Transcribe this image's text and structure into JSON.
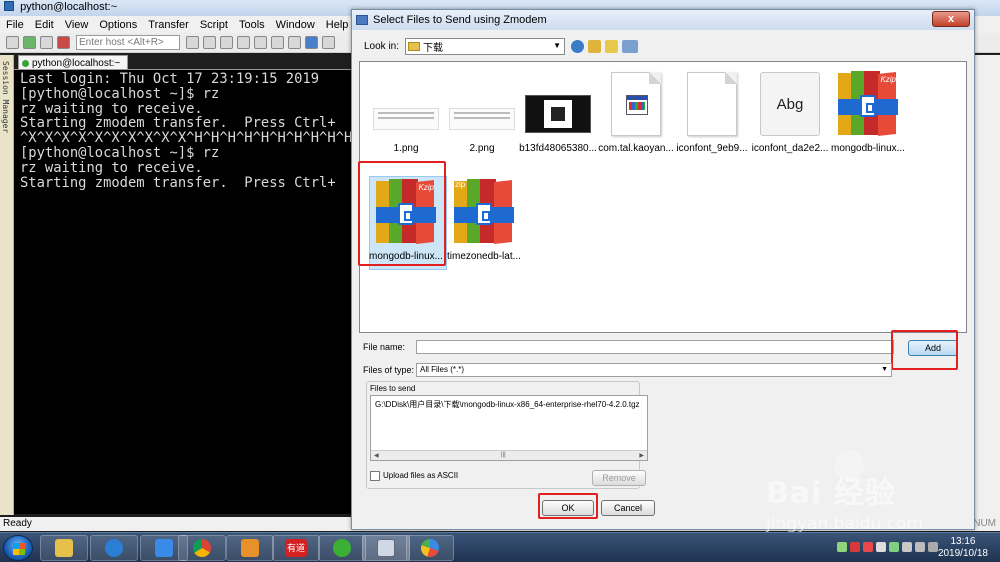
{
  "crt": {
    "title": "python@localhost:~",
    "menu": [
      "File",
      "Edit",
      "View",
      "Options",
      "Transfer",
      "Script",
      "Tools",
      "Window",
      "Help"
    ],
    "host_placeholder": "Enter host <Alt+R>",
    "session_manager_label": "Session Manager",
    "tab_label": "python@localhost:~",
    "terminal_lines": [
      "Last login: Thu Oct 17 23:19:15 2019",
      "[python@localhost ~]$ rz",
      "rz waiting to receive.",
      "Starting zmodem transfer.  Press Ctrl+",
      "",
      "^X^X^X^X^X^X^X^X^X^X^H^H^H^H^H^H^H^H^H^H^",
      "[python@localhost ~]$ rz",
      "rz waiting to receive.",
      "Starting zmodem transfer.  Press Ctrl+"
    ],
    "status_text": "Ready",
    "status_right": "NUM"
  },
  "dialog": {
    "title": "Select Files to Send using Zmodem",
    "close_label": "x",
    "look_in_label": "Look in:",
    "look_in_value": "下载",
    "files": [
      {
        "name": "1.png",
        "kind": "png"
      },
      {
        "name": "2.png",
        "kind": "png"
      },
      {
        "name": "b13fd48065380...",
        "kind": "qr"
      },
      {
        "name": "com.tal.kaoyan...",
        "kind": "app"
      },
      {
        "name": "iconfont_9eb9...",
        "kind": "blank"
      },
      {
        "name": "iconfont_da2e2...",
        "kind": "abg"
      },
      {
        "name": "mongodb-linux...",
        "kind": "kzip"
      },
      {
        "name": "mongodb-linux...",
        "kind": "kzip",
        "selected": true
      },
      {
        "name": "timezonedb-lat...",
        "kind": "zip"
      }
    ],
    "abg_text": "Abg",
    "kzip_badge": "Kzip",
    "zip_badge": "zip",
    "file_name_label": "File name:",
    "file_name_value": "",
    "file_type_label": "Files of type:",
    "file_type_value": "All Files (*.*)",
    "add_label": "Add",
    "files_to_send_label": "Files to send",
    "files_to_send": [
      "G:\\DDisk\\用户目录\\下载\\mongodb-linux-x86_64-enterprise-rhel70-4.2.0.tgz"
    ],
    "remove_label": "Remove",
    "upload_ascii_label": "Upload files as ASCII",
    "ok_label": "OK",
    "cancel_label": "Cancel"
  },
  "watermark": {
    "brand": "Bai 经验",
    "url": "jingyan.baidu.com"
  },
  "taskbar": {
    "apps": [
      "explorer",
      "media-player",
      "feather-app",
      "chrome",
      "vmware",
      "youdao",
      "wechat",
      "securecrt",
      "paint"
    ],
    "youdao_label": "有道",
    "time": "13:16",
    "date": "2019/10/18"
  }
}
